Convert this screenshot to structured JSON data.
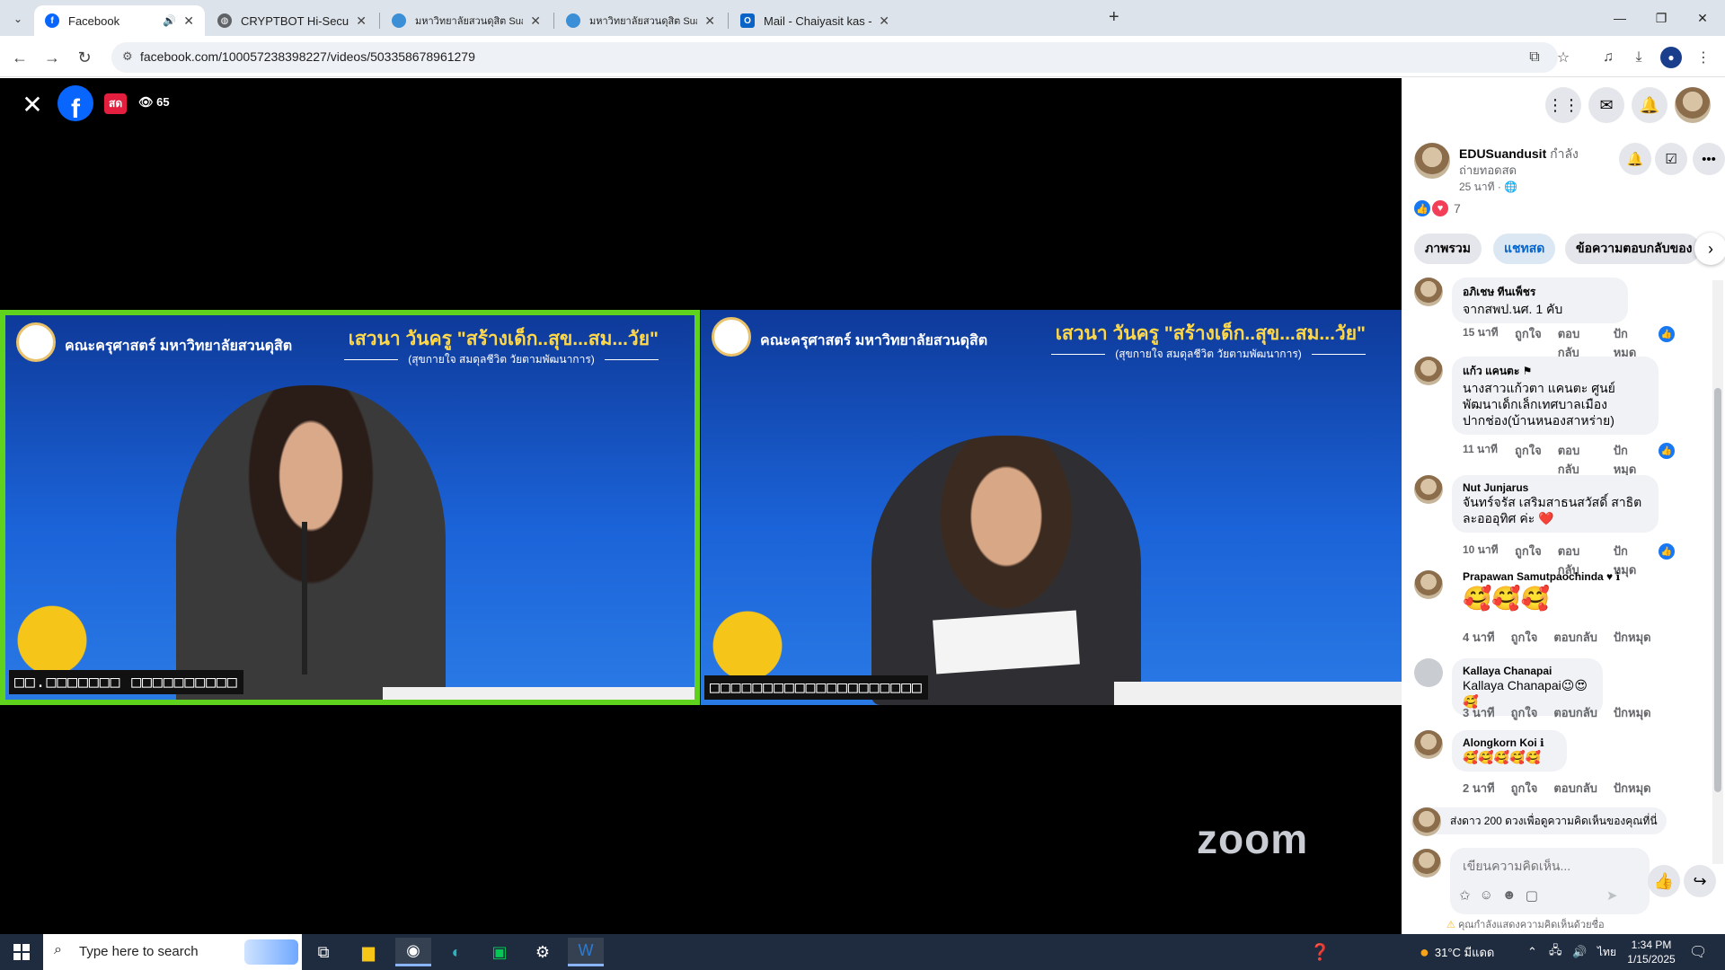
{
  "browser": {
    "tabs": [
      {
        "title": "Facebook",
        "active": true,
        "icon": "facebook-icon"
      },
      {
        "title": "CRYPTBOT Hi-Secure e-Office",
        "active": false,
        "icon": "globe-icon"
      },
      {
        "title": "มหาวิทยาลัยสวนดุสิต Suan Dusit U",
        "active": false,
        "icon": "university-icon"
      },
      {
        "title": "มหาวิทยาลัยสวนดุสิต Suan Dusit U",
        "active": false,
        "icon": "university-icon"
      },
      {
        "title": "Mail - Chaiyasit kas - Outlook",
        "active": false,
        "icon": "outlook-icon"
      }
    ],
    "new_tab": "+",
    "url": "facebook.com/100057238398227/videos/503358678961279"
  },
  "video": {
    "live_label": "สด",
    "viewer_count": "65",
    "faculty_title": "คณะครุศาสตร์ มหาวิทยาลัยสวนดุสิต",
    "seminar_title": "เสวนา วันครู \"สร้างเด็ก..สุข...สม...วัย\"",
    "seminar_subtitle": "(สุขกายใจ สมดุลชีวิต วัยตามพัฒนาการ)",
    "left_nameplate": "□□.□□□□□□□ □□□□□□□□□□",
    "right_nameplate": "□□□□□□□□□□□□□□□□□□□□",
    "watermark": "zoom",
    "colors": {
      "active_speaker_border": "#5fd21e",
      "live_badge": "#e41e3f"
    }
  },
  "sidebar": {
    "page_name": "EDUSuandusit",
    "status_suffix": "กำลัง",
    "status_line2": "ถ่ายทอดสด",
    "time_ago": "25 นาที · 🌐",
    "reaction_count": "7",
    "tabs": [
      "ภาพรวม",
      "แชทสด",
      "ข้อความตอบกลับของ"
    ],
    "comments": [
      {
        "name": "อภิเชษ ทีนเพ็ชร",
        "text": "จากสพป.นศ. 1 คับ",
        "time": "15 นาที",
        "like": "ถูกใจ",
        "reply": "ตอบกลับ",
        "pin": "ปักหมุด"
      },
      {
        "name": "แก้ว แคนตะ",
        "text": "นางสาวแก้วตา แคนตะ ศูนย์พัฒนาเด็กเล็กเทศบาลเมืองปากช่อง(บ้านหนองสาหร่าย)",
        "time": "11 นาที",
        "like": "ถูกใจ",
        "reply": "ตอบกลับ",
        "pin": "ปักหมุด"
      },
      {
        "name": "Nut Junjarus",
        "text": "จันทร์จรัส เสริมสาธนสวัสดิ์ สาธิตละอออุทิศ ค่ะ ❤️",
        "time": "10 นาที",
        "like": "ถูกใจ",
        "reply": "ตอบกลับ",
        "pin": "ปักหมุด"
      },
      {
        "name": "Prapawan Samutpaochinda",
        "text": "🥰🥰🥰",
        "time": "4 นาที",
        "like": "ถูกใจ",
        "reply": "ตอบกลับ",
        "pin": "ปักหมุด"
      },
      {
        "name": "Kallaya Chanapai",
        "text": "Kallaya Chanapai😉😍🥰",
        "time": "3 นาที",
        "like": "ถูกใจ",
        "reply": "ตอบกลับ",
        "pin": "ปักหมุด"
      },
      {
        "name": "Alongkorn Koi",
        "text": "🥰🥰🥰🥰🥰",
        "time": "2 นาที",
        "like": "ถูกใจ",
        "reply": "ตอบกลับ",
        "pin": "ปักหมุด"
      }
    ],
    "stars_prompt": "ส่งดาว 200 ดวงเพื่อดูความคิดเห็นของคุณที่นี่",
    "comment_placeholder": "เขียนความคิดเห็น...",
    "notice": "คุณกำลังแสดงความคิดเห็นด้วยชื่อ"
  },
  "taskbar": {
    "search_placeholder": "Type here to search",
    "weather": "31°C มีแดด",
    "language": "ไทย",
    "time": "1:34 PM",
    "date": "1/15/2025"
  }
}
